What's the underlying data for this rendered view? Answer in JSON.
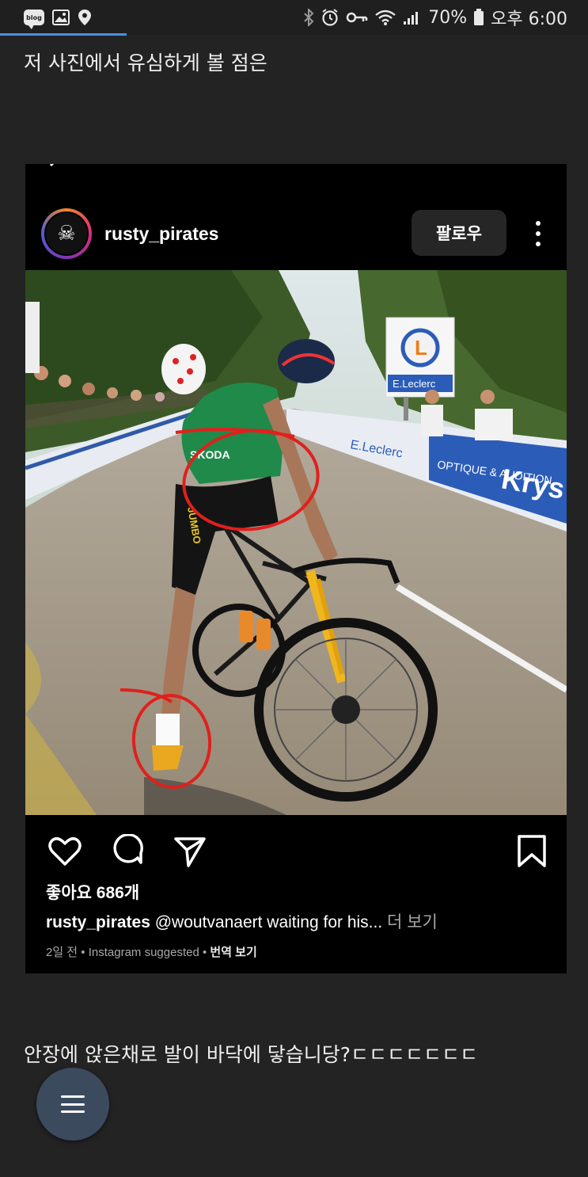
{
  "status_bar": {
    "blog_badge": "blog",
    "battery": "70%",
    "time": "오후 6:00",
    "left_icons": [
      "blog-notification-icon",
      "gallery-icon",
      "location-icon"
    ],
    "right_icons": [
      "bluetooth-icon",
      "alarm-icon",
      "key-icon",
      "wifi-icon",
      "signal-icon",
      "battery-icon"
    ]
  },
  "post": {
    "question_text": "저 사진에서 유심하게 볼  점은",
    "answer_text": "안장에 앉은채로 발이 바닥에 닿습니당?ㄷㄷㄷㄷㄷㄷㄷ"
  },
  "instagram": {
    "username": "rusty_pirates",
    "follow_label": "팔로우",
    "likes": "좋아요 686개",
    "caption_user": "rusty_pirates",
    "caption_text": " @woutvanaert waiting for his...",
    "caption_more": " 더 보기",
    "meta_time": "2일 전",
    "meta_suggested": "Instagram suggested",
    "meta_translate": "번역 보기",
    "photo": {
      "jersey_brand": "SKODA",
      "shorts_text": "JUMBO",
      "sign_brand": "E.Leclerc",
      "sign_letter": "L",
      "banner_left": "OPTIQUE & AUDITION",
      "banner_right": "Krys"
    }
  },
  "colors": {
    "background": "#232323",
    "status_bar": "#1f1f1f",
    "accent_progress": "#4a90e2",
    "fab": "#3c4a5e",
    "annotation_red": "#e0201d"
  }
}
